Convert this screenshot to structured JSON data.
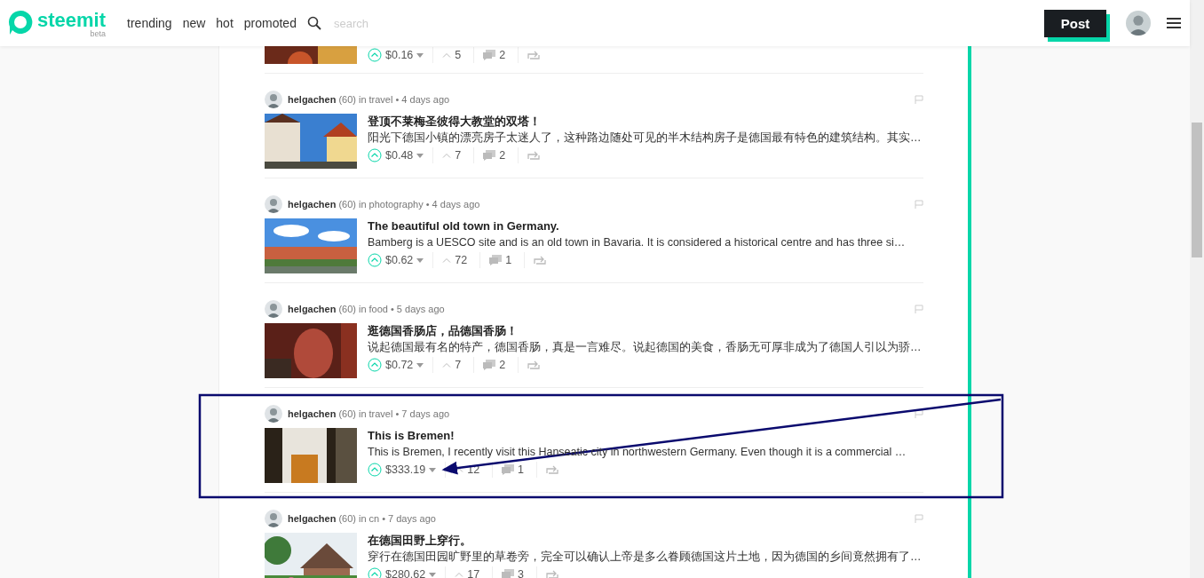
{
  "header": {
    "logo": "steemit",
    "logo_tag": "beta",
    "nav": [
      {
        "label": "trending"
      },
      {
        "label": "new"
      },
      {
        "label": "hot"
      },
      {
        "label": "promoted"
      }
    ],
    "search": {
      "placeholder": "search"
    },
    "post_button": "Post"
  },
  "posts": [
    {
      "kind": "partial",
      "payout": "$0.16",
      "votes": "5",
      "comments": "2"
    },
    {
      "kind": "full",
      "author": "helgachen",
      "reputation": "(60)",
      "category_prefix": "in",
      "category": "travel",
      "time": "• 4 days ago",
      "title": "登顶不莱梅圣彼得大教堂的双塔！",
      "body": "阳光下德国小镇的漂亮房子太迷人了，这种路边随处可见的半木结构房子是德国最有特色的建筑结构。其实…",
      "payout": "$0.48",
      "votes": "7",
      "comments": "2"
    },
    {
      "kind": "full",
      "author": "helgachen",
      "reputation": "(60)",
      "category_prefix": "in",
      "category": "photography",
      "time": "• 4 days ago",
      "title": "The beautiful old town in Germany.",
      "body": "Bamberg is a UESCO site and is an old town in Bavaria. It is considered a historical centre and has three si…",
      "payout": "$0.62",
      "votes": "72",
      "comments": "1"
    },
    {
      "kind": "full",
      "author": "helgachen",
      "reputation": "(60)",
      "category_prefix": "in",
      "category": "food",
      "time": "• 5 days ago",
      "title": "逛德国香肠店，品德国香肠！",
      "body": "说起德国最有名的特产，德国香肠，真是一言难尽。说起德国的美食，香肠无可厚非成为了德国人引以为骄…",
      "payout": "$0.72",
      "votes": "7",
      "comments": "2"
    },
    {
      "kind": "full",
      "author": "helgachen",
      "reputation": "(60)",
      "category_prefix": "in",
      "category": "travel",
      "time": "• 7 days ago",
      "title": "This is Bremen!",
      "body": "This is Bremen, I recently visit this Hanseatic city in northwestern Germany. Even though it is a commercial …",
      "payout": "$333.19",
      "votes": "12",
      "comments": "1"
    },
    {
      "kind": "full",
      "author": "helgachen",
      "reputation": "(60)",
      "category_prefix": "in",
      "category": "cn",
      "time": "• 7 days ago",
      "title": "在德国田野上穿行。",
      "body": "穿行在德国田园旷野里的草卷旁，完全可以确认上帝是多么眷顾德国这片土地，因为德国的乡间竟然拥有了…",
      "payout": "$280.62",
      "votes": "17",
      "comments": "3"
    }
  ]
}
